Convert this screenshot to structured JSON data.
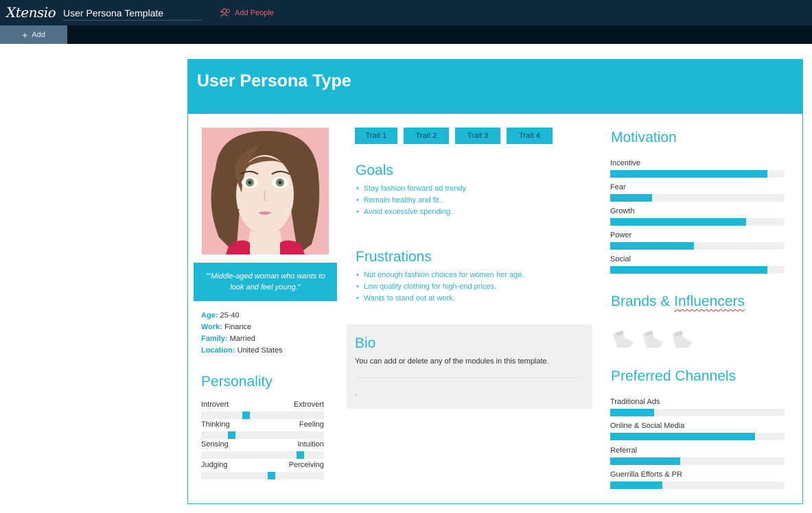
{
  "app": {
    "logo": "Xtensio",
    "doc_title": "User Persona Template",
    "add_people_label": "Add People",
    "add_label": "Add"
  },
  "persona": {
    "title": "User Persona Type",
    "quote": "\"\"Middle-aged woman who wants to look and feel young.\"",
    "facts": [
      {
        "key": "Age:",
        "value": "25-40"
      },
      {
        "key": "Work:",
        "value": "Finance"
      },
      {
        "key": "Family:",
        "value": "Married"
      },
      {
        "key": "Location:",
        "value": "United States"
      }
    ],
    "personality": {
      "heading": "Personality",
      "rows": [
        {
          "left": "Introvert",
          "right": "Extrovert",
          "level": 0.36
        },
        {
          "left": "Thinking",
          "right": "Feeling",
          "level": 0.23
        },
        {
          "left": "Sensing",
          "right": "Intuition",
          "level": 0.83
        },
        {
          "left": "Judging",
          "right": "Perceiving",
          "level": 0.58
        }
      ]
    },
    "traits": [
      "Trait 1",
      "Trait 2",
      "Trait 3",
      "Trait 4"
    ],
    "goals": {
      "heading": "Goals",
      "items": [
        "Stay fashion forward ad trendy.",
        "Remain healthy and fit..",
        "Avoid excessive spending."
      ]
    },
    "frustrations": {
      "heading": "Frustrations",
      "items": [
        "Not enough fashion choices for women her age.",
        "Low quality clothing for high-end prices.",
        "Wants to stand out at work."
      ]
    },
    "bio": {
      "heading": "Bio",
      "text": "You can add or delete any of the modules in this template.",
      "footer": "."
    },
    "motivation": {
      "heading": "Motivation",
      "items": [
        {
          "label": "Incentive",
          "level": 0.9
        },
        {
          "label": "Fear",
          "level": 0.24
        },
        {
          "label": "Growth",
          "level": 0.78
        },
        {
          "label": "Power",
          "level": 0.48
        },
        {
          "label": "Social",
          "level": 0.9
        }
      ]
    },
    "brands": {
      "heading_a": "Brands & ",
      "heading_b": "Influencers",
      "logos": [
        "brand-placeholder-icon",
        "brand-placeholder-icon",
        "brand-placeholder-icon"
      ]
    },
    "channels": {
      "heading": "Preferred Channels",
      "items": [
        {
          "label": "Traditional Ads",
          "level": 0.25
        },
        {
          "label": "Online & Social Media",
          "level": 0.83
        },
        {
          "label": "Referral",
          "level": 0.4
        },
        {
          "label": "Guerrilla Efforts & PR",
          "level": 0.3
        }
      ]
    }
  },
  "colors": {
    "accent": "#1cb8d6",
    "topbar": "#0f2a3c",
    "track": "#efefef"
  }
}
